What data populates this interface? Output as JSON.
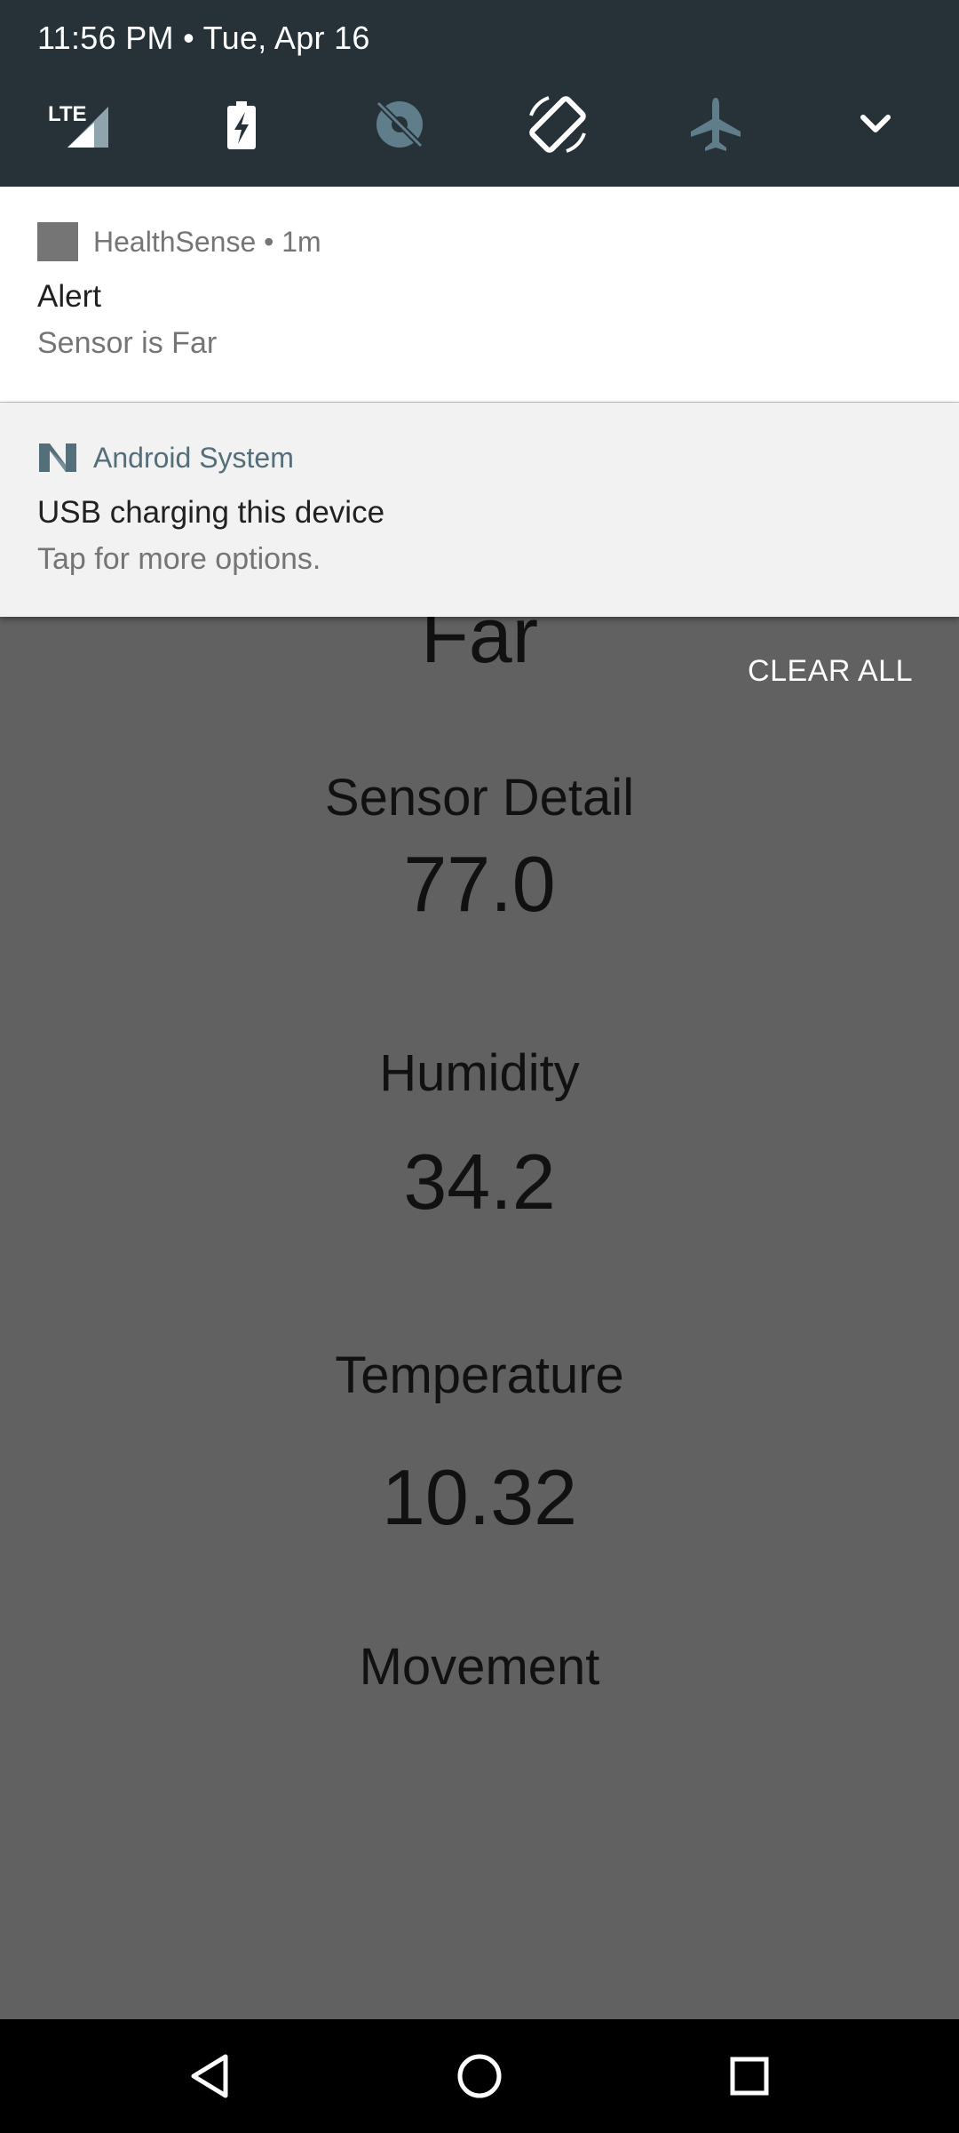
{
  "status": {
    "datetime": "11:56 PM • Tue, Apr 16",
    "tiles": {
      "lte_label": "LTE",
      "icons": [
        "lte-signal-icon",
        "battery-charging-icon",
        "location-off-icon",
        "auto-rotate-icon",
        "airplane-mode-icon",
        "expand-chevron-icon"
      ]
    }
  },
  "notifications": [
    {
      "app": "HealthSense • 1m",
      "title": "Alert",
      "text": "Sensor is Far"
    },
    {
      "app": "Android System",
      "title": "USB charging this device",
      "text": "Tap for more options."
    }
  ],
  "clear_all": "CLEAR ALL",
  "app": {
    "proximity_value": "Far",
    "sensor_detail_label": "Sensor Detail",
    "sensor_detail_value": "77.0",
    "humidity_label": "Humidity",
    "humidity_value": "34.2",
    "temperature_label": "Temperature",
    "temperature_value": "10.32",
    "movement_label": "Movement"
  },
  "colors": {
    "quick_settings_bg": "#263238",
    "scrim": "#616161",
    "android_system_accent": "#546e7a"
  }
}
